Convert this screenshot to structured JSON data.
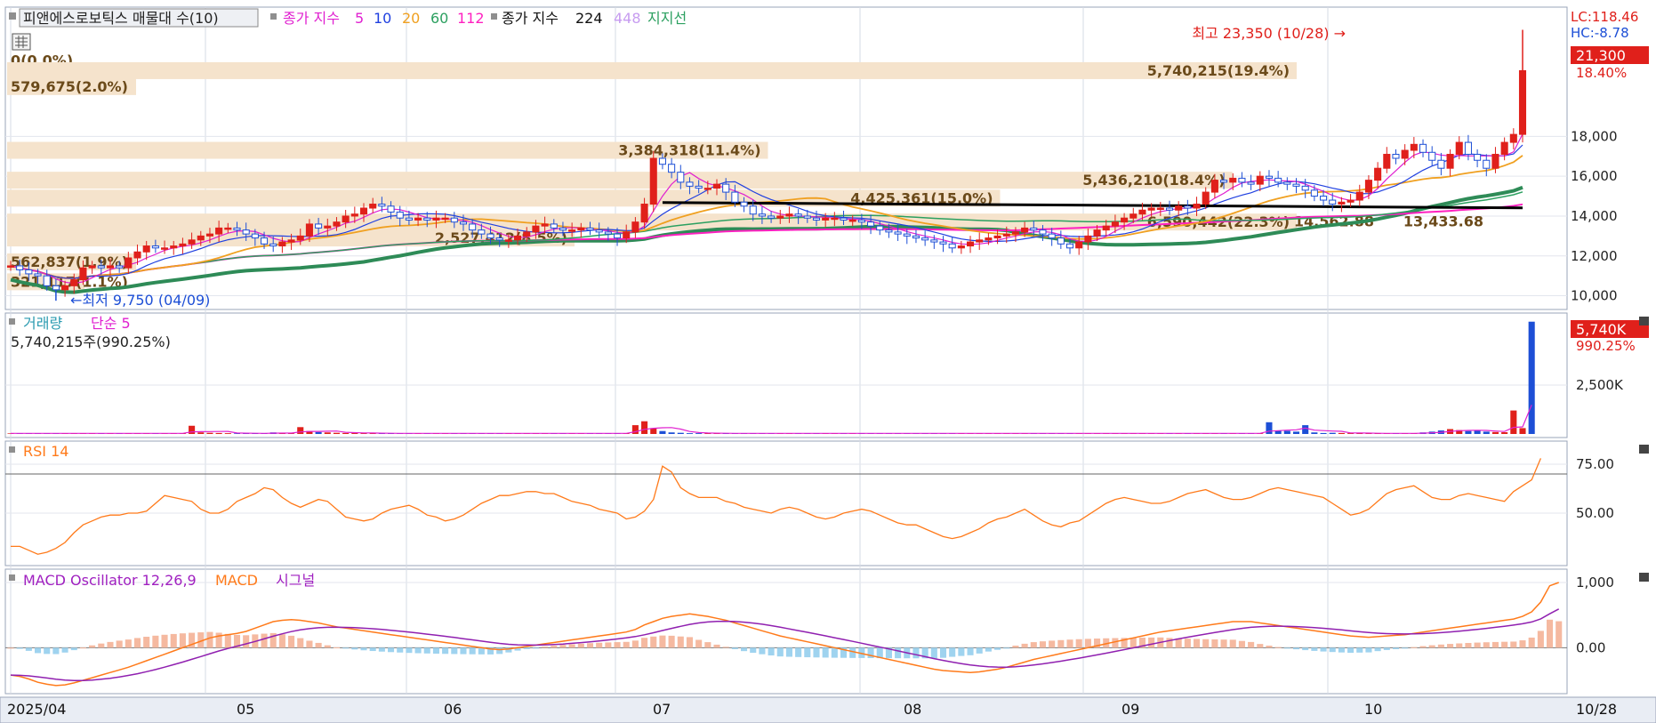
{
  "header": {
    "title_box": "피앤에스로보틱스 매물대 수(10)",
    "legend_ma_label": "종가 지수",
    "ma_periods": [
      "5",
      "10",
      "20",
      "60",
      "112"
    ],
    "legend_ma2_label": "종가 지수",
    "ma2_periods": [
      "224",
      "448"
    ],
    "support_label": "지지선"
  },
  "right_labels": {
    "lc": "LC:118.46",
    "hc": "HC:-8.78",
    "price_now": "21,300",
    "change_pct": "18.40%",
    "volume_now": "5,740K",
    "volume_pct": "990.25%"
  },
  "annotations": {
    "high": "최고 23,350 (10/28) →",
    "low": "←최저 9,750 (04/09)"
  },
  "volume_panel": {
    "title": "거래량",
    "ma_label": "단순 5",
    "info": "5,740,215주(990.25%)"
  },
  "rsi_panel": {
    "title": "RSI 14"
  },
  "macd_panel": {
    "title": "MACD Oscillator 12,26,9",
    "macd": "MACD",
    "signal": "시그널"
  },
  "x_labels": [
    "2025/04",
    "05",
    "06",
    "07",
    "08",
    "09",
    "10",
    "10/28"
  ],
  "colors": {
    "up": "#e0201b",
    "down": "#1d4fd6",
    "ma5": "#e020d0",
    "ma10": "#2040e0",
    "ma20": "#f0a020",
    "ma60": "#2ca060",
    "ma112": "#ff20c0",
    "ma224": "#2e8b57",
    "rsi": "#ff7a1a",
    "macd": "#ff7a1a",
    "signal": "#9020b0",
    "volband": "#f5e3cc"
  },
  "chart_data": [
    {
      "type": "candlestick",
      "title": "피앤에스로보틱스",
      "ylim": [
        9400,
        24400
      ],
      "yticks": [
        "10,000",
        "12,000",
        "14,000",
        "16,000",
        "18,000"
      ],
      "ytick_values": [
        10000,
        12000,
        14000,
        16000,
        18000
      ],
      "series_close": [
        11500,
        11300,
        11100,
        11000,
        10500,
        10300,
        10500,
        10800,
        11400,
        11500,
        11400,
        11500,
        11400,
        11900,
        12200,
        12500,
        12400,
        12400,
        12500,
        12600,
        12800,
        13000,
        13100,
        13400,
        13400,
        13300,
        13100,
        12900,
        12600,
        12500,
        12700,
        12800,
        13000,
        13600,
        13400,
        13500,
        13700,
        14000,
        14100,
        14400,
        14600,
        14500,
        14200,
        13900,
        13800,
        13900,
        13800,
        13900,
        13900,
        13700,
        13600,
        13300,
        13100,
        12900,
        12800,
        12800,
        13000,
        13200,
        13500,
        13600,
        13400,
        13300,
        13300,
        13400,
        13300,
        13200,
        13100,
        12900,
        13200,
        13700,
        14600,
        16900,
        16600,
        16200,
        15700,
        15500,
        15400,
        15400,
        15600,
        15200,
        14700,
        14500,
        14100,
        14000,
        13900,
        14000,
        14100,
        14000,
        13900,
        13800,
        13900,
        13900,
        13800,
        13800,
        13700,
        13500,
        13300,
        13200,
        13100,
        13000,
        12900,
        12800,
        12700,
        12600,
        12400,
        12500,
        12700,
        12800,
        12900,
        13000,
        13100,
        13200,
        13400,
        13300,
        13100,
        12900,
        12600,
        12400,
        12700,
        13000,
        13300,
        13500,
        13700,
        13900,
        14100,
        14300,
        14400,
        14400,
        14300,
        14500,
        14400,
        14600,
        15200,
        15800,
        15700,
        15900,
        15700,
        15600,
        16000,
        15900,
        15700,
        15600,
        15500,
        15300,
        15000,
        14800,
        14600,
        14700,
        14800,
        15200,
        15800,
        16400,
        17100,
        16900,
        17300,
        17600,
        17200,
        16800,
        16400,
        17100,
        17700,
        17100,
        16800,
        16400,
        17100,
        17700,
        18100,
        21300
      ],
      "support_value": 14500,
      "high": {
        "label": "최고 23,350 (10/28)",
        "value": 23350
      },
      "low": {
        "label": "최저 9,750 (04/09)",
        "value": 9750
      },
      "volume_profile": [
        {
          "label": "0(0.0%)",
          "price": 21800,
          "width": 0
        },
        {
          "label": "5,740,215(19.4%)",
          "price": 21300,
          "width": 1.0
        },
        {
          "label": "579,675(2.0%)",
          "price": 20500,
          "width": 0.1
        },
        {
          "label": "3,384,318(11.4%)",
          "price": 17300,
          "width": 0.59
        },
        {
          "label": "5,436,210(18.4%)",
          "price": 15800,
          "width": 0.95
        },
        {
          "label": "4,425,361(15.0%)",
          "price": 14900,
          "width": 0.77
        },
        {
          "label": "6,590,442(22.3%)",
          "price": 13700,
          "width": 1.0
        },
        {
          "label": "2,527,412(8.5%)",
          "price": 12900,
          "width": 0.44
        },
        {
          "label": "562,837(1.9%)",
          "price": 11700,
          "width": 0.1
        },
        {
          "label": "321,117(1.1%)",
          "price": 10700,
          "width": 0.06
        }
      ],
      "extra_labels": [
        "14,562.88",
        "13,433.68"
      ]
    },
    {
      "type": "bar",
      "title": "거래량",
      "ylim": [
        0,
        6000
      ],
      "yticks": [
        "2,500K"
      ],
      "ytick_values": [
        2500
      ],
      "volume_k": [
        30,
        30,
        30,
        30,
        30,
        30,
        30,
        30,
        30,
        30,
        30,
        30,
        30,
        30,
        30,
        30,
        30,
        30,
        30,
        30,
        420,
        80,
        60,
        50,
        40,
        30,
        30,
        40,
        30,
        80,
        40,
        30,
        350,
        150,
        100,
        80,
        60,
        50,
        50,
        40,
        40,
        30,
        30,
        30,
        30,
        30,
        30,
        30,
        30,
        30,
        30,
        30,
        30,
        30,
        30,
        30,
        30,
        30,
        30,
        30,
        30,
        30,
        30,
        30,
        30,
        30,
        30,
        30,
        30,
        450,
        650,
        300,
        150,
        80,
        60,
        40,
        40,
        40,
        30,
        30,
        30,
        30,
        30,
        30,
        30,
        30,
        30,
        30,
        30,
        30,
        30,
        30,
        30,
        30,
        30,
        30,
        30,
        30,
        30,
        30,
        30,
        30,
        30,
        30,
        30,
        30,
        30,
        30,
        30,
        30,
        30,
        30,
        30,
        30,
        30,
        30,
        30,
        30,
        30,
        30,
        30,
        30,
        30,
        30,
        30,
        30,
        30,
        30,
        30,
        30,
        30,
        30,
        30,
        30,
        30,
        30,
        30,
        30,
        30,
        600,
        160,
        160,
        120,
        450,
        80,
        50,
        60,
        50,
        40,
        40,
        30,
        30,
        30,
        30,
        30,
        30,
        80,
        120,
        180,
        250,
        200,
        150,
        180,
        120,
        100,
        90,
        1200,
        300,
        5740
      ]
    },
    {
      "type": "line",
      "title": "RSI 14",
      "ylim": [
        25,
        85
      ],
      "yticks": [
        "50.00",
        "75.00"
      ],
      "ytick_values": [
        50,
        75
      ],
      "reference": 70,
      "values": [
        33,
        33,
        31,
        29,
        30,
        32,
        35,
        40,
        44,
        46,
        48,
        49,
        49,
        50,
        50,
        51,
        55,
        59,
        58,
        57,
        56,
        52,
        50,
        50,
        52,
        56,
        58,
        60,
        63,
        62,
        58,
        55,
        53,
        55,
        57,
        56,
        52,
        48,
        47,
        46,
        47,
        50,
        52,
        53,
        54,
        52,
        49,
        48,
        46,
        47,
        49,
        52,
        55,
        57,
        59,
        59,
        60,
        61,
        61,
        60,
        60,
        58,
        56,
        55,
        54,
        52,
        51,
        50,
        47,
        48,
        51,
        57,
        74,
        71,
        63,
        60,
        58,
        58,
        58,
        56,
        55,
        53,
        52,
        51,
        50,
        52,
        53,
        52,
        50,
        48,
        47,
        48,
        50,
        51,
        52,
        51,
        49,
        47,
        45,
        44,
        44,
        42,
        40,
        38,
        37,
        38,
        40,
        42,
        45,
        47,
        48,
        50,
        52,
        49,
        46,
        44,
        43,
        45,
        46,
        49,
        52,
        55,
        57,
        58,
        57,
        56,
        55,
        55,
        56,
        58,
        60,
        61,
        62,
        60,
        58,
        57,
        57,
        58,
        60,
        62,
        63,
        62,
        61,
        60,
        59,
        58,
        55,
        52,
        49,
        50,
        52,
        56,
        60,
        62,
        63,
        64,
        61,
        58,
        57,
        57,
        59,
        60,
        59,
        58,
        57,
        56,
        61,
        64,
        67,
        78
      ]
    },
    {
      "type": "line",
      "title": "MACD Oscillator 12,26,9",
      "ylim": [
        -650,
        1150
      ],
      "yticks": [
        "0.00",
        "1,000"
      ],
      "ytick_values": [
        0,
        1000
      ],
      "macd": [
        -420,
        -440,
        -480,
        -530,
        -560,
        -580,
        -570,
        -540,
        -500,
        -460,
        -420,
        -380,
        -340,
        -300,
        -250,
        -200,
        -150,
        -100,
        -50,
        0,
        50,
        100,
        150,
        180,
        200,
        220,
        250,
        300,
        350,
        400,
        420,
        430,
        420,
        400,
        380,
        350,
        320,
        300,
        280,
        260,
        240,
        220,
        200,
        180,
        160,
        140,
        120,
        100,
        80,
        60,
        40,
        20,
        0,
        -20,
        -30,
        -20,
        0,
        20,
        40,
        60,
        80,
        100,
        120,
        140,
        160,
        180,
        200,
        220,
        240,
        280,
        350,
        400,
        450,
        480,
        500,
        520,
        500,
        480,
        450,
        420,
        380,
        340,
        300,
        260,
        220,
        180,
        150,
        120,
        90,
        60,
        30,
        0,
        -30,
        -60,
        -90,
        -120,
        -150,
        -180,
        -210,
        -240,
        -270,
        -300,
        -330,
        -350,
        -360,
        -370,
        -380,
        -370,
        -350,
        -330,
        -300,
        -260,
        -220,
        -180,
        -150,
        -120,
        -90,
        -60,
        -30,
        0,
        30,
        60,
        90,
        120,
        150,
        180,
        210,
        240,
        260,
        280,
        300,
        320,
        340,
        360,
        380,
        400,
        400,
        400,
        380,
        360,
        340,
        320,
        300,
        280,
        260,
        240,
        220,
        200,
        180,
        170,
        160,
        170,
        180,
        190,
        200,
        220,
        240,
        260,
        280,
        300,
        320,
        340,
        360,
        380,
        400,
        420,
        440,
        480,
        550,
        700,
        950,
        1000
      ]
    }
  ]
}
